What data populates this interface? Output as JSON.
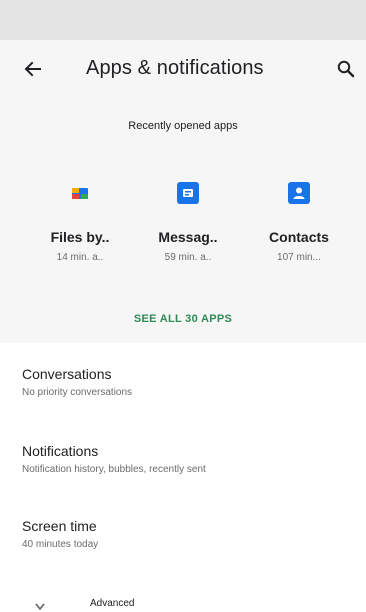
{
  "header": {
    "title": "Apps & notifications",
    "back_icon": "back-arrow-icon",
    "search_icon": "search-icon"
  },
  "recent": {
    "heading": "Recently opened apps",
    "apps": [
      {
        "name": "Files by..",
        "time": "14 min. a..",
        "icon": "files-app-icon",
        "color": "#1a73e8"
      },
      {
        "name": "Messag..",
        "time": "59 min. a..",
        "icon": "messages-app-icon",
        "color": "#1a73e8"
      },
      {
        "name": "Contacts",
        "time": "107 min...",
        "icon": "contacts-app-icon",
        "color": "#1a73e8"
      }
    ],
    "see_all": "SEE ALL 30 APPS"
  },
  "settings": [
    {
      "title": "Conversations",
      "summary": "No priority conversations"
    },
    {
      "title": "Notifications",
      "summary": "Notification history, bubbles, recently sent"
    },
    {
      "title": "Screen time",
      "summary": "40 minutes today"
    }
  ],
  "advanced": {
    "label": "Advanced",
    "icon": "chevron-down-icon"
  },
  "colors": {
    "accent": "#2e8b57",
    "app_blue": "#1a73e8",
    "panel": "#f6f6f6"
  }
}
